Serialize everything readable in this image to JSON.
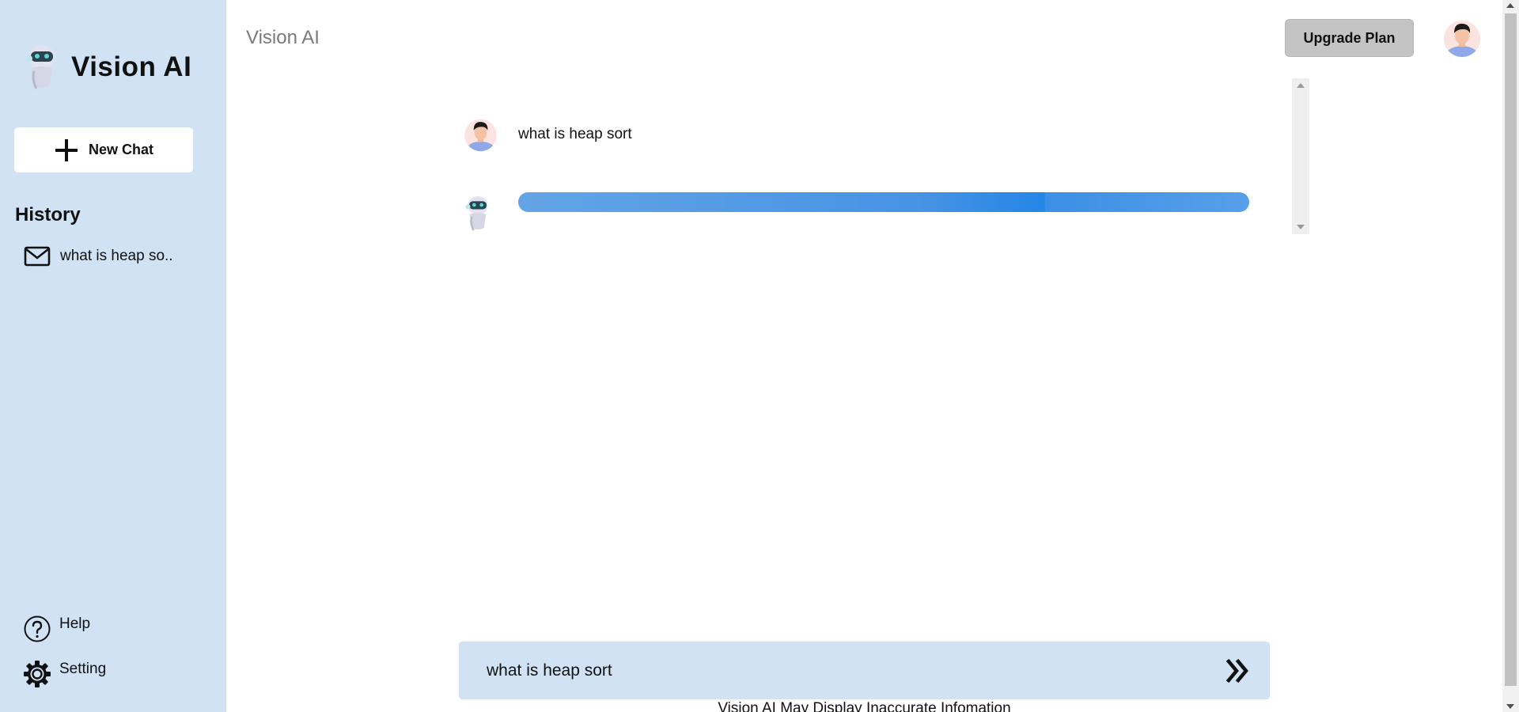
{
  "sidebar": {
    "brand_name": "Vision AI",
    "brand_icon": "robot-icon",
    "new_chat_label": "New Chat",
    "history_title": "History",
    "history_items": [
      {
        "label": "what is heap so..",
        "icon": "mail-icon"
      }
    ],
    "help_label": "Help",
    "setting_label": "Setting"
  },
  "header": {
    "title": "Vision AI",
    "upgrade_label": "Upgrade Plan"
  },
  "chat": {
    "messages": [
      {
        "role": "user",
        "text": "what is heap sort",
        "icon": "user-avatar"
      },
      {
        "role": "assistant",
        "status": "loading",
        "icon": "robot-icon"
      }
    ]
  },
  "prompt": {
    "value": "what is heap sort",
    "send_icon": "double-chevron-right-icon"
  },
  "footer": {
    "disclaimer": "Vision AI May Display Inaccurate Infomation"
  },
  "colors": {
    "sidebar_bg": "#d0e2f4",
    "loading_bar": "#2486e6",
    "upgrade_bg": "#c4c4c4"
  }
}
